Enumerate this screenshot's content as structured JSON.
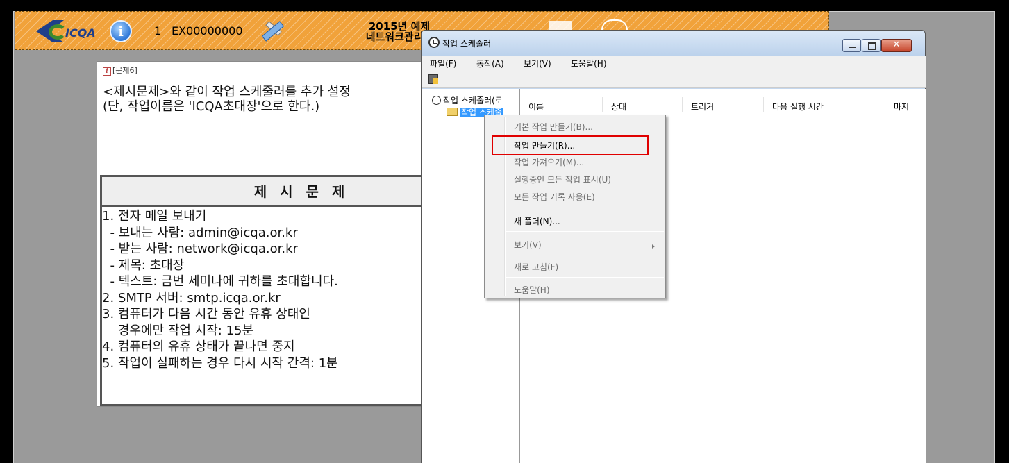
{
  "exam_header": {
    "logo_text": "ICQA",
    "exam_number": "1",
    "exam_code": "EX00000000",
    "title_line1": "2015년 예제",
    "title_line2": "네트워크관리사"
  },
  "question": {
    "tag": "[문제6]",
    "text": "<제시문제>와 같이 작업 스케줄러를 추가 설정\n(단, 작업이름은 'ICQA초대장'으로 한다.)",
    "box_title": "제 시 문 제",
    "lines": [
      "1. 전자 메일 보내기",
      "  - 보내는 사람: admin@icqa.or.kr",
      "  - 받는 사람: network@icqa.or.kr",
      "  - 제목: 초대장",
      "  - 텍스트: 금번 세미나에 귀하를 초대합니다.",
      "2. SMTP 서버: smtp.icqa.or.kr",
      "3. 컴퓨터가 다음 시간 동안 유휴 상태인",
      "    경우에만 작업 시작: 15분",
      "4. 컴퓨터의 유휴 상태가 끝나면 중지",
      "5. 작업이 실패하는 경우 다시 시작 간격: 1분"
    ]
  },
  "scheduler": {
    "title": "작업 스케줄러",
    "close_glyph": "✕",
    "menu": [
      "파일(F)",
      "동작(A)",
      "보기(V)",
      "도움말(H)"
    ],
    "tree_root": "작업 스케줄러(로",
    "tree_child": "작업 스케줄",
    "columns": [
      "이름",
      "상태",
      "트리거",
      "다음 실행 시간",
      "마지"
    ]
  },
  "context_menu": {
    "items": [
      {
        "label": "기본 작업 만들기(B)...",
        "enabled": false
      },
      {
        "label": "작업 만들기(R)...",
        "enabled": true
      },
      {
        "label": "작업 가져오기(M)...",
        "enabled": false
      },
      {
        "label": "실행중인 모든 작업 표시(U)",
        "enabled": false
      },
      {
        "label": "모든 작업 기록 사용(E)",
        "enabled": false
      },
      {
        "label": "새 폴더(N)...",
        "enabled": true
      },
      {
        "label": "보기(V)",
        "enabled": false,
        "submenu": true
      },
      {
        "label": "새로 고침(F)",
        "enabled": false
      },
      {
        "label": "도움말(H)",
        "enabled": false
      }
    ],
    "highlighted": "작업 만들기(R)..."
  },
  "colors": {
    "header_orange": "#f1a23a",
    "highlight_red": "#e00000",
    "selection_blue": "#3399ff"
  }
}
